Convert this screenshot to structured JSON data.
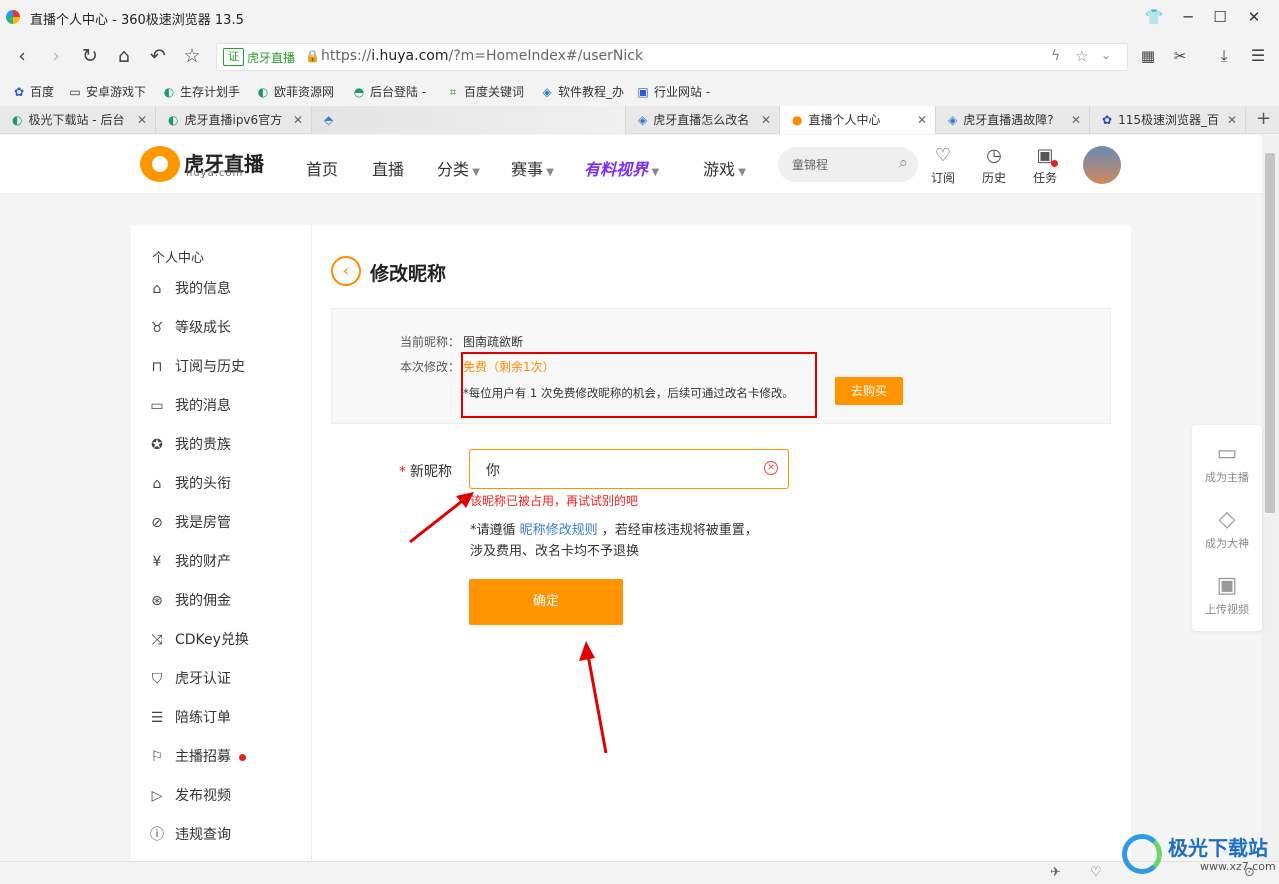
{
  "window": {
    "title": "直播个人中心 - 360极速浏览器 13.5"
  },
  "browser": {
    "cert_label": "证",
    "site_label": "虎牙直播",
    "url_prefix": "https://",
    "url_host": "i.huya.com",
    "url_path": "/?m=HomeIndex#/userNick"
  },
  "bookmarks": [
    "百度",
    "安卓游戏下",
    "生存计划手",
    "欧菲资源网",
    "后台登陆 -",
    "百度关键词",
    "软件教程_办",
    "行业网站 -"
  ],
  "tabs": [
    {
      "label": "极光下载站 - 后台"
    },
    {
      "label": "虎牙直播ipv6官方"
    },
    {
      "label": ""
    },
    {
      "label": "虎牙直播怎么改名"
    },
    {
      "label": "直播个人中心"
    },
    {
      "label": "虎牙直播遇故障?"
    },
    {
      "label": "115极速浏览器_百"
    }
  ],
  "huya": {
    "logo_text": "虎牙直播",
    "logo_sub": "huya.com",
    "nav": [
      "首页",
      "直播",
      "分类",
      "赛事",
      "有料视界",
      "游戏"
    ],
    "search_placeholder": "童锦程",
    "icons": [
      {
        "name": "订阅"
      },
      {
        "name": "历史"
      },
      {
        "name": "任务"
      }
    ]
  },
  "sidebar": {
    "heading": "个人中心",
    "items": [
      "我的信息",
      "等级成长",
      "订阅与历史",
      "我的消息",
      "我的贵族",
      "我的头衔",
      "我是房管",
      "我的财产",
      "我的佣金",
      "CDKey兑换",
      "虎牙认证",
      "陪练订单",
      "主播招募",
      "发布视频",
      "违规查询"
    ]
  },
  "page": {
    "title": "修改昵称",
    "current_label": "当前昵称：",
    "current_value": "图南疏欲断",
    "change_label": "本次修改：",
    "change_value": "免费（剩余1次）",
    "note": "*每位用户有 1 次免费修改昵称的机会，后续可通过改名卡修改。",
    "buy_label": "去购买",
    "new_label": "新昵称",
    "new_value": "你",
    "error": "该昵称已被占用，再试试别的吧",
    "rule_prefix": "*请遵循 ",
    "rule_link": "昵称修改规则",
    "rule_suffix": " ，若经审核违规将被重置，",
    "rule_line2": "涉及费用、改名卡均不予退换",
    "confirm_label": "确定"
  },
  "float_panel": [
    {
      "label": "成为主播"
    },
    {
      "label": "成为大神"
    },
    {
      "label": "上传视频"
    }
  ],
  "watermark": {
    "title": "极光下载站",
    "url": "www.xz7.com"
  }
}
